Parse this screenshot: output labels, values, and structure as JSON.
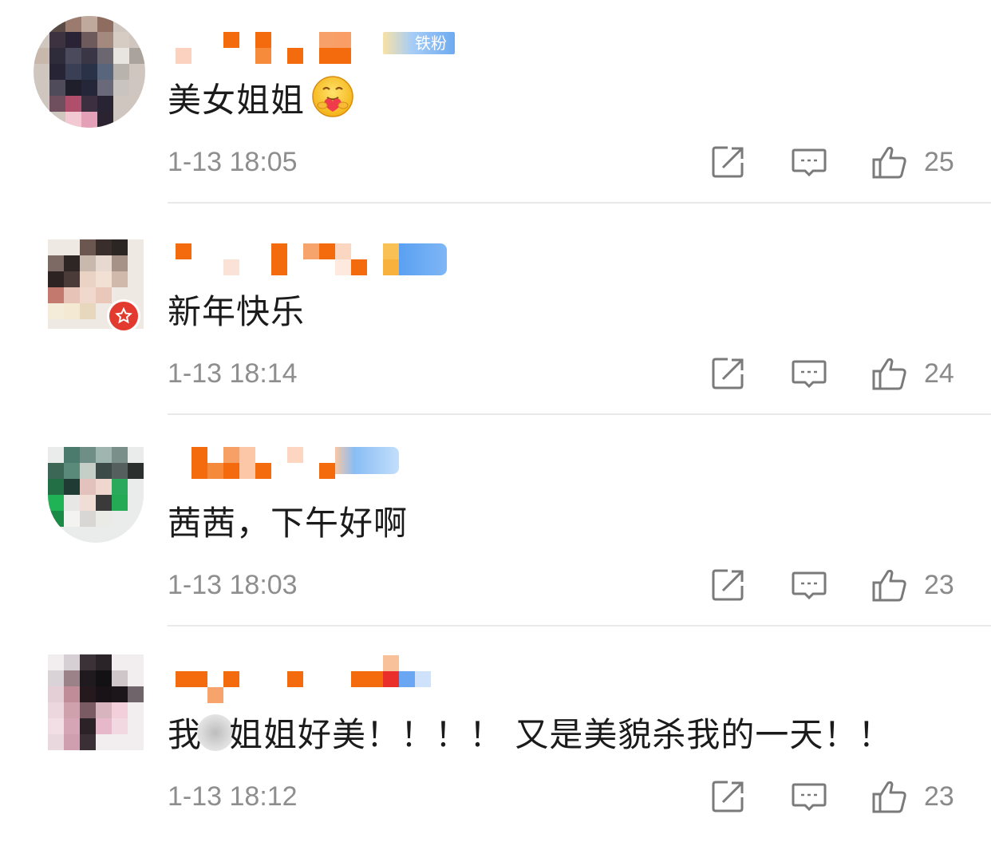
{
  "comments": [
    {
      "text": "美女姐姐",
      "emoji": "hugging-face-emoji",
      "time": "1-13 18:05",
      "likes": "25",
      "badge_text": "铁粉"
    },
    {
      "text": "新年快乐",
      "time": "1-13 18:14",
      "likes": "24",
      "verified": "star-badge-icon"
    },
    {
      "text": "茜茜，下午好啊",
      "time": "1-13 18:03",
      "likes": "23"
    },
    {
      "text_before": "我",
      "text_after": "姐姐好美！！！！ 又是美貌杀我的一天！！",
      "time": "1-13 18:12",
      "likes": "23"
    }
  ],
  "icons": {
    "forward": "share-forward-icon",
    "reply": "comment-bubble-icon",
    "like": "thumbs-up-icon"
  },
  "colors": {
    "text": "#1b1b1b",
    "meta": "#8e8e8e",
    "icon": "#7a7a7a",
    "divider": "#e9e9e9",
    "name_orange": "#f36b0c",
    "badge_blue": "#5da0ef"
  }
}
